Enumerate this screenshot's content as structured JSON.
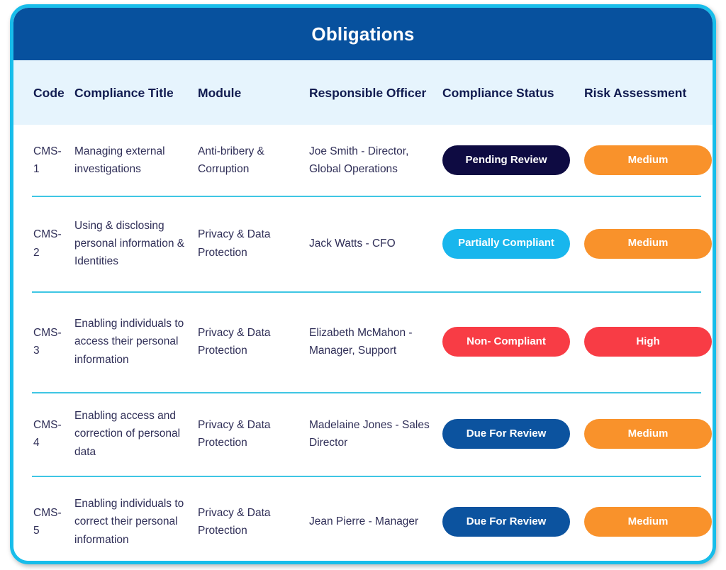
{
  "card": {
    "title": "Obligations",
    "border_color": "#18BDEA",
    "title_band_color": "#07519E",
    "header_band_color": "#E6F4FD",
    "divider_color": "#3FC6E4"
  },
  "table": {
    "columns": [
      {
        "key": "code",
        "label": "Code"
      },
      {
        "key": "title",
        "label": "Compliance Title"
      },
      {
        "key": "module",
        "label": "Module"
      },
      {
        "key": "officer",
        "label": "Responsible Officer"
      },
      {
        "key": "status",
        "label": "Compliance Status"
      },
      {
        "key": "risk",
        "label": "Risk Assessment"
      }
    ],
    "rows": [
      {
        "code": "CMS-1",
        "title": "Managing external investigations",
        "module": "Anti-bribery & Corruption",
        "officer": "Joe Smith - Director, Global Operations",
        "status": {
          "label": "Pending Review",
          "color": "#0E0B42"
        },
        "risk": {
          "label": "Medium",
          "color": "#F9922B"
        }
      },
      {
        "code": "CMS-2",
        "title": "Using & disclosing personal information & Identities",
        "module": "Privacy & Data Protection",
        "officer": "Jack Watts - CFO",
        "status": {
          "label": "Partially Compliant",
          "color": "#18B6ED"
        },
        "risk": {
          "label": "Medium",
          "color": "#F9922B"
        }
      },
      {
        "code": "CMS-3",
        "title": "Enabling individuals to access their personal information",
        "module": "Privacy & Data Protection",
        "officer": "Elizabeth McMahon - Manager, Support",
        "status": {
          "label": "Non- Compliant",
          "color": "#F83C45"
        },
        "risk": {
          "label": "High",
          "color": "#F83C45"
        }
      },
      {
        "code": "CMS-4",
        "title": "Enabling access and correction of personal data",
        "module": "Privacy & Data Protection",
        "officer": "Madelaine Jones - Sales Director",
        "status": {
          "label": "Due For Review",
          "color": "#0C539F"
        },
        "risk": {
          "label": "Medium",
          "color": "#F9922B"
        }
      },
      {
        "code": "CMS-5",
        "title": "Enabling individuals to correct their personal information",
        "module": "Privacy & Data Protection",
        "officer": "Jean Pierre - Manager",
        "status": {
          "label": "Due For Review",
          "color": "#0C539F"
        },
        "risk": {
          "label": "Medium",
          "color": "#F9922B"
        }
      }
    ]
  }
}
